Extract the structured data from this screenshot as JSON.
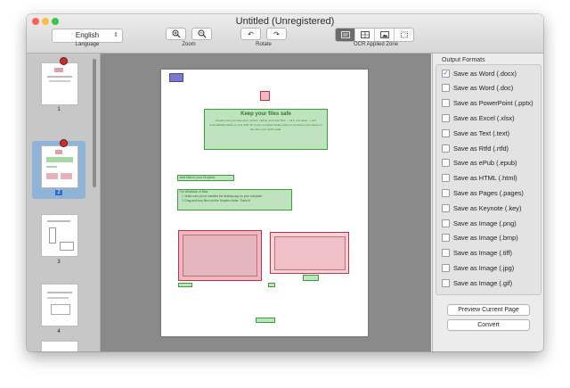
{
  "window": {
    "title": "Untitled (Unregistered)"
  },
  "colors": {
    "close": "#fc605c",
    "minimize": "#fdbc40",
    "zoom": "#34c84a",
    "accent": "#2263d6",
    "selection": "#8fb4d8",
    "text_zone": "#48b048",
    "image_zone": "#d65060"
  },
  "toolbar": {
    "language": {
      "value": "English",
      "label": "Language"
    },
    "zoom": {
      "label": "Zoom",
      "icons": [
        "zoom-in-icon",
        "zoom-out-icon"
      ]
    },
    "rotate": {
      "label": "Rotate",
      "icons": [
        "rotate-left-icon",
        "rotate-right-icon"
      ]
    },
    "ocr_zone": {
      "label": "OCR Applied Zone",
      "icons": [
        "text-zone-icon",
        "table-zone-icon",
        "image-zone-icon",
        "crop-zone-icon"
      ],
      "selected": "text-zone-icon"
    }
  },
  "sidebar": {
    "pages": [
      {
        "number": "1",
        "selected": false,
        "pinned": true
      },
      {
        "number": "2",
        "selected": true,
        "pinned": true
      },
      {
        "number": "3",
        "selected": false,
        "pinned": false
      },
      {
        "number": "4",
        "selected": false,
        "pinned": false
      }
    ]
  },
  "document": {
    "heading": "Keep your files safe",
    "body": "Dropbox lets you save docs, photos, videos, and other files — all in one place — and automatically backs up your stuff. So if your computer breaks down or you leave your phone on the train, your stuff is safe.",
    "subheading": "Add files to your Dropbox",
    "instructions_title": "On Windows or Mac",
    "instructions": [
      "1. Make sure you've installed the desktop app on your computer.",
      "2. Drag and drop files into the Dropbox folder. That's it!"
    ]
  },
  "output_formats": {
    "title": "Output Formats",
    "options": [
      {
        "label": "Save as Word (.docx)",
        "checked": true
      },
      {
        "label": "Save as Word (.doc)",
        "checked": false
      },
      {
        "label": "Save as PowerPoint (.pptx)",
        "checked": false
      },
      {
        "label": "Save as Excel (.xlsx)",
        "checked": false
      },
      {
        "label": "Save as Text (.text)",
        "checked": false
      },
      {
        "label": "Save as Rtfd (.rtfd)",
        "checked": false
      },
      {
        "label": "Save as ePub (.epub)",
        "checked": false
      },
      {
        "label": "Save as HTML (.html)",
        "checked": false
      },
      {
        "label": "Save as Pages (.pages)",
        "checked": false
      },
      {
        "label": "Save as Keynote (.key)",
        "checked": false
      },
      {
        "label": "Save as Image (.png)",
        "checked": false
      },
      {
        "label": "Save as Image (.bmp)",
        "checked": false
      },
      {
        "label": "Save as Image (.tiff)",
        "checked": false
      },
      {
        "label": "Save as Image (.jpg)",
        "checked": false
      },
      {
        "label": "Save as Image (.gif)",
        "checked": false
      }
    ]
  },
  "actions": {
    "preview": "Preview Current Page",
    "convert": "Convert"
  }
}
